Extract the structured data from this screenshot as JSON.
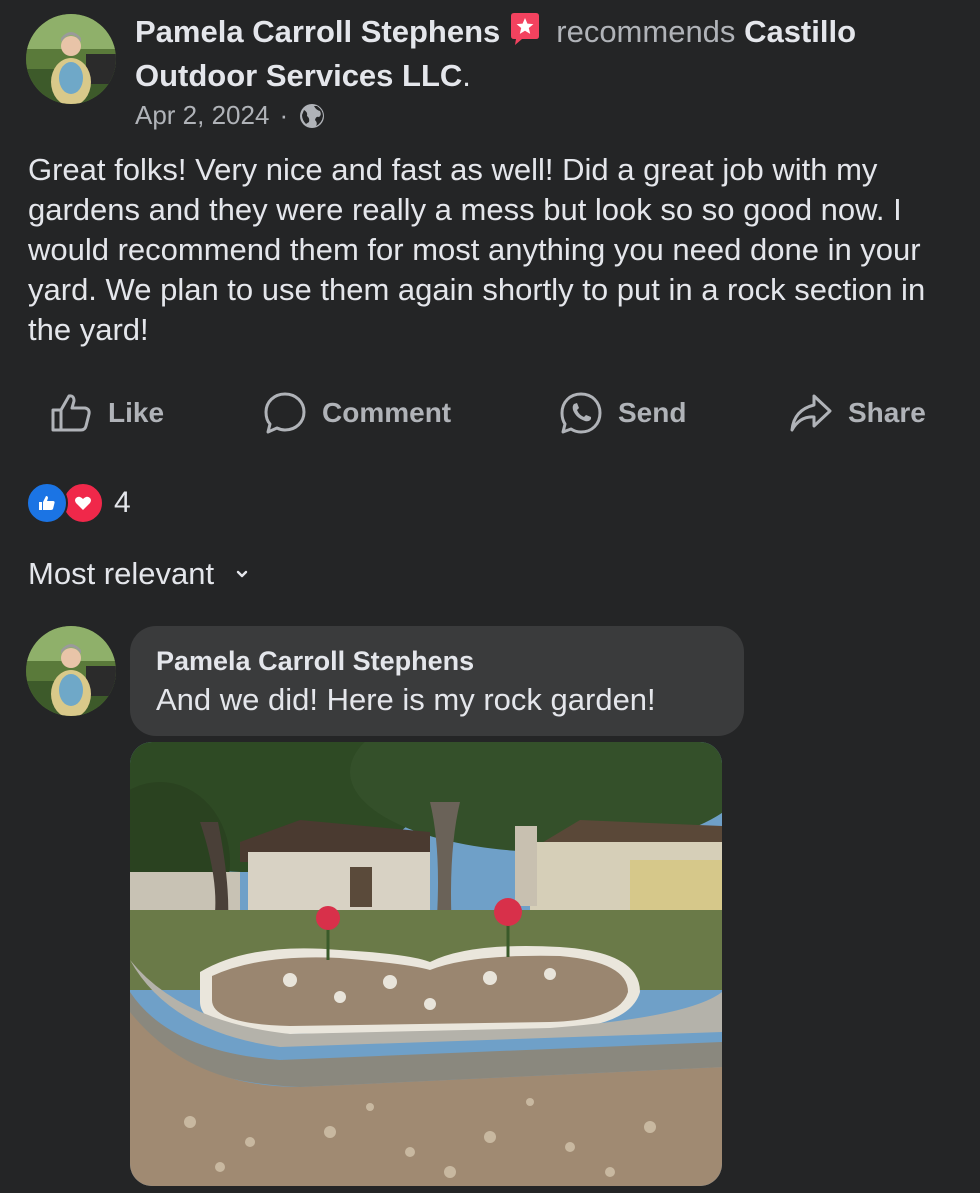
{
  "post": {
    "author": "Pamela Carroll Stephens",
    "recommends": "recommends",
    "business_line1": "Castillo",
    "business_line2": "Outdoor Services LLC",
    "date": "Apr 2, 2024",
    "separator": "·",
    "privacy_icon": "globe-icon",
    "body": "Great folks!  Very nice and fast as well!  Did a great job with my gardens and they were really a mess but look so so good now. I would recommend them for most anything you need done in your yard. We plan to use them again shortly to put in a rock section in the yard!"
  },
  "actions": {
    "like": "Like",
    "comment": "Comment",
    "send": "Send",
    "share": "Share"
  },
  "reactions": {
    "count": "4",
    "types": [
      "like",
      "love"
    ]
  },
  "comments_sort": "Most relevant",
  "comment": {
    "author": "Pamela Carroll Stephens",
    "text": "And we did!  Here is my rock garden!"
  },
  "colors": {
    "background": "#242526",
    "bubble": "#3a3b3c",
    "text": "#e4e6eb",
    "muted": "#b0b3b8",
    "like_blue": "#1b74e4",
    "love_red": "#f0284a",
    "recommend_badge": "#f3425f"
  }
}
